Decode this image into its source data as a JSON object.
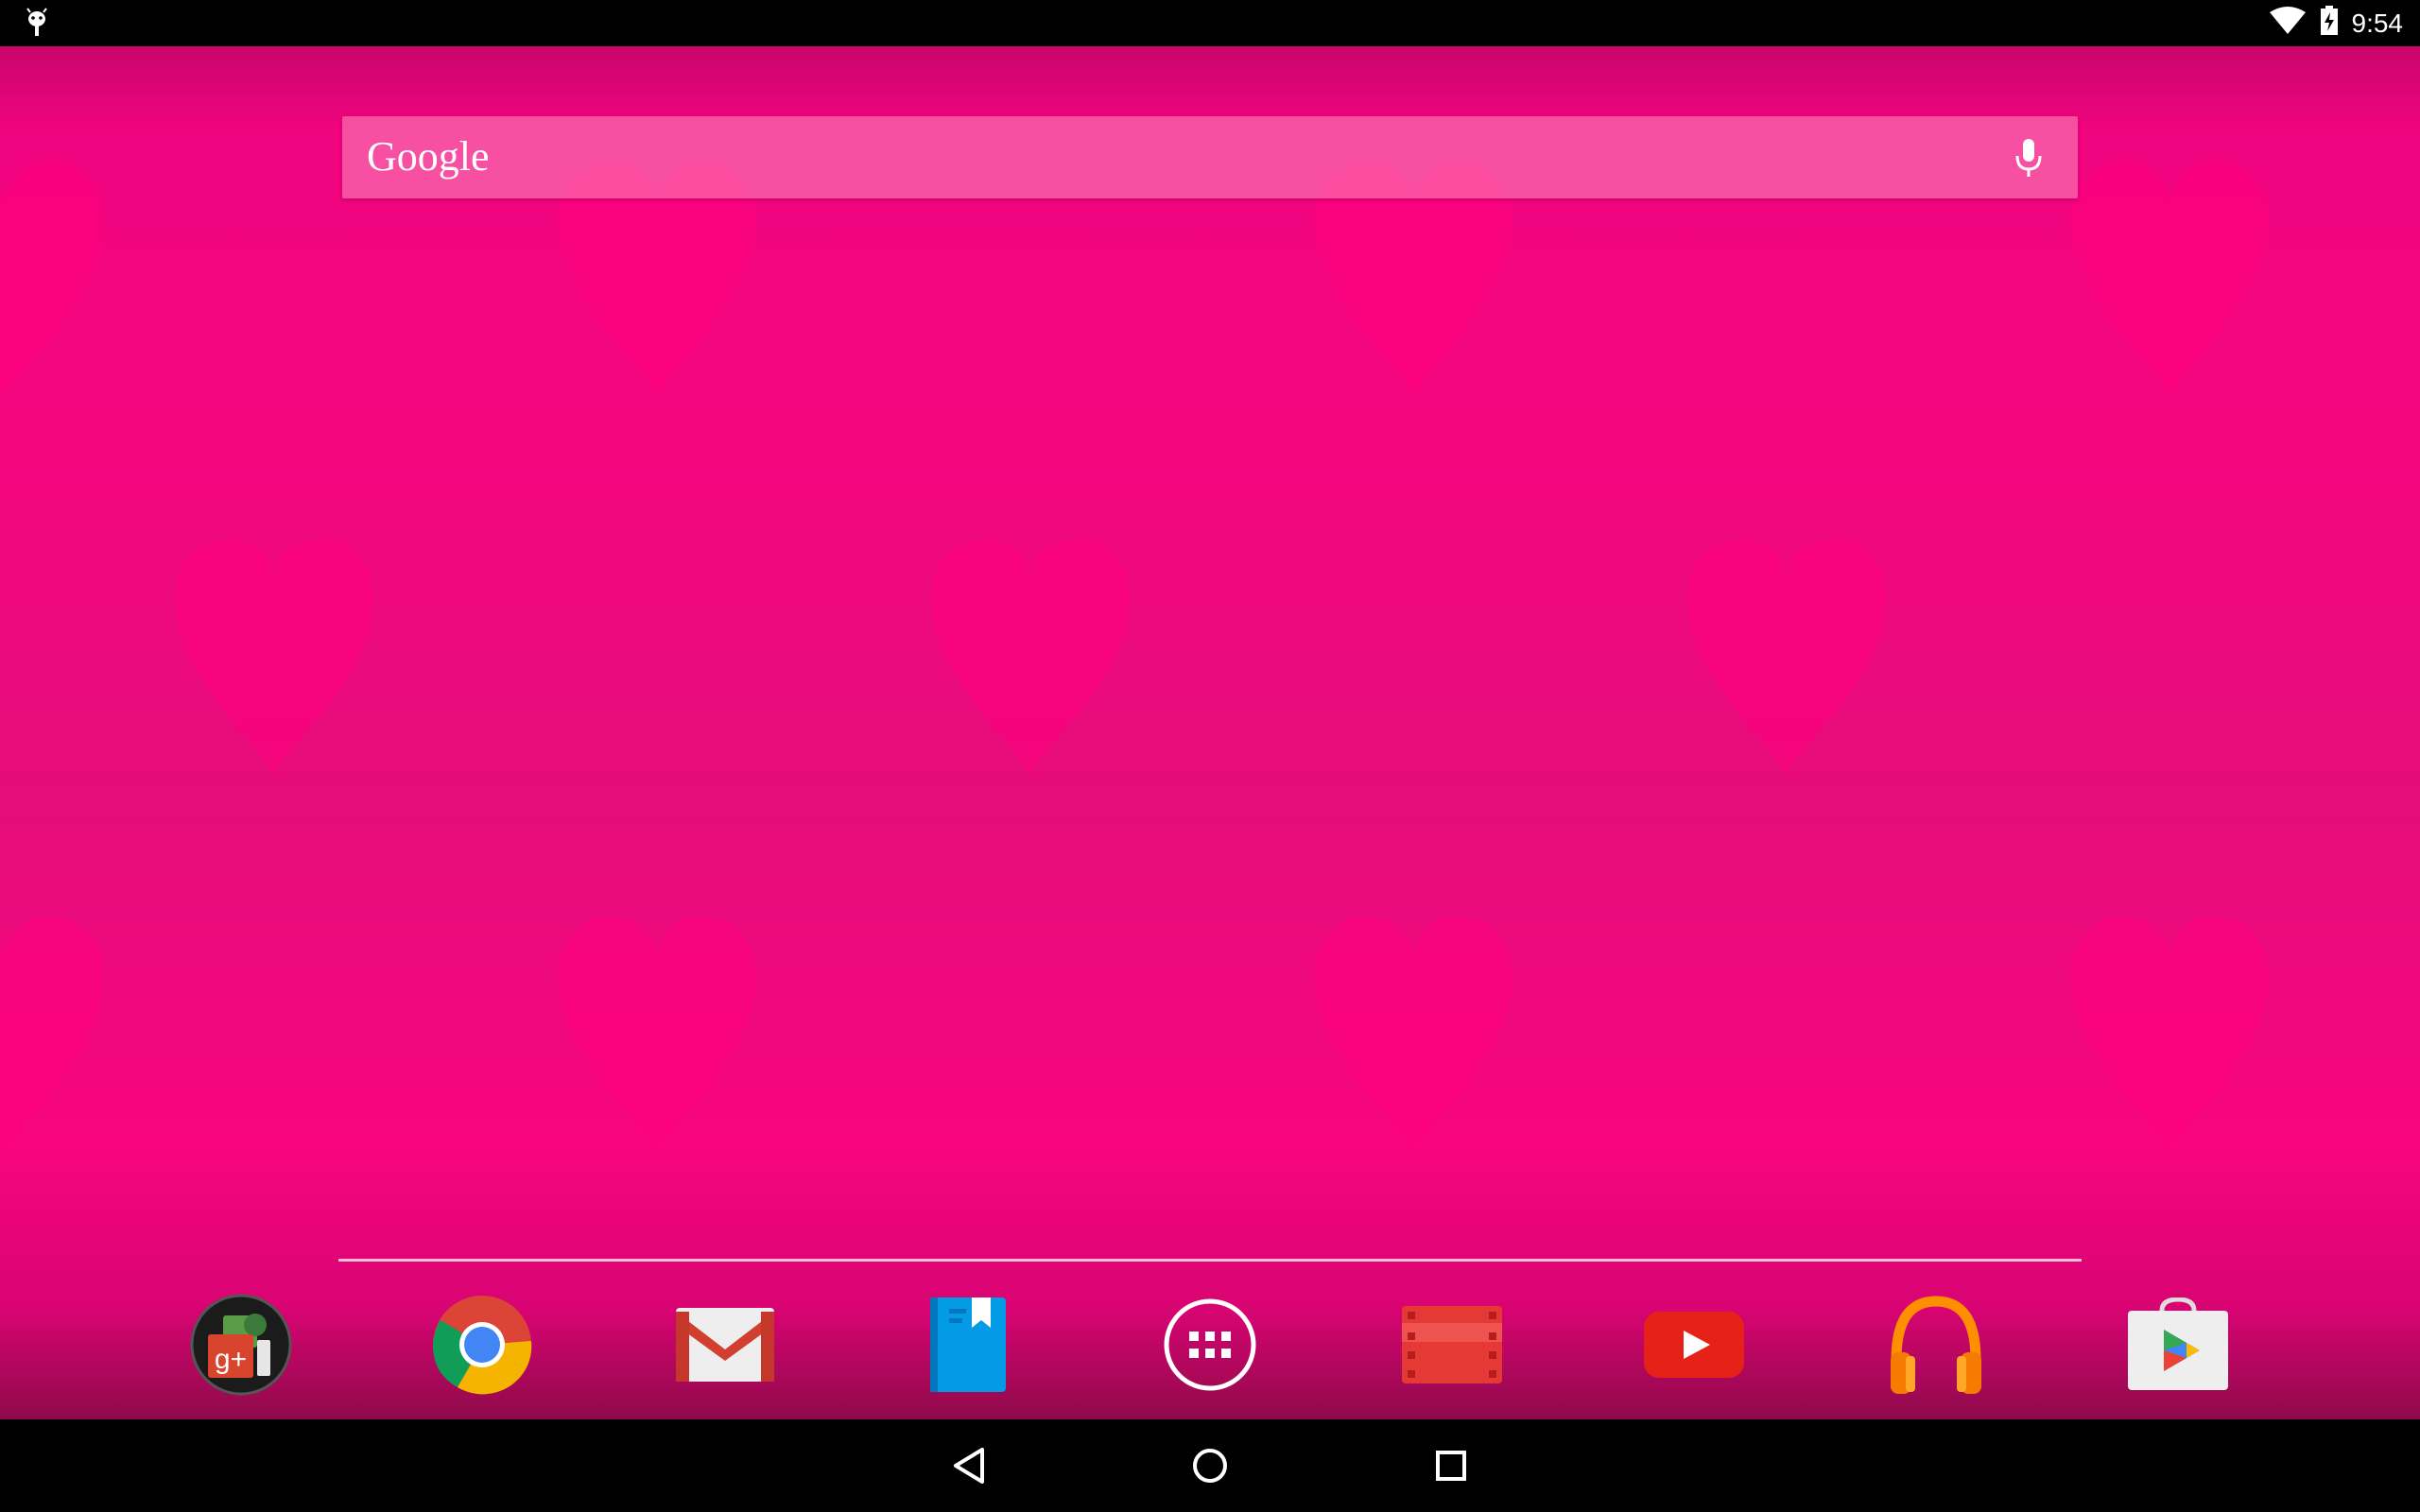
{
  "status_bar": {
    "notification_icon": "android-debug-icon",
    "wifi_icon": "wifi-icon",
    "battery_icon": "battery-charging-icon",
    "time": "9:54"
  },
  "search": {
    "logo_text": "Google",
    "mic_icon": "microphone-icon"
  },
  "dock": {
    "apps": [
      {
        "name": "google-plus-folder",
        "icon": "google-plus-icon",
        "glyph": "g+"
      },
      {
        "name": "chrome",
        "icon": "chrome-icon"
      },
      {
        "name": "gmail",
        "icon": "gmail-icon"
      },
      {
        "name": "play-books",
        "icon": "books-icon"
      },
      {
        "name": "all-apps",
        "icon": "app-drawer-icon"
      },
      {
        "name": "play-movies",
        "icon": "movies-icon"
      },
      {
        "name": "youtube",
        "icon": "youtube-icon"
      },
      {
        "name": "play-music",
        "icon": "headphones-icon"
      },
      {
        "name": "play-store",
        "icon": "play-store-icon"
      }
    ]
  },
  "nav_bar": {
    "back_icon": "back-icon",
    "home_icon": "home-icon",
    "recents_icon": "recents-icon"
  },
  "colors": {
    "wallpaper_pink": "#f4067f",
    "status_bar_bg": "#000000",
    "nav_bar_bg": "#000000"
  }
}
